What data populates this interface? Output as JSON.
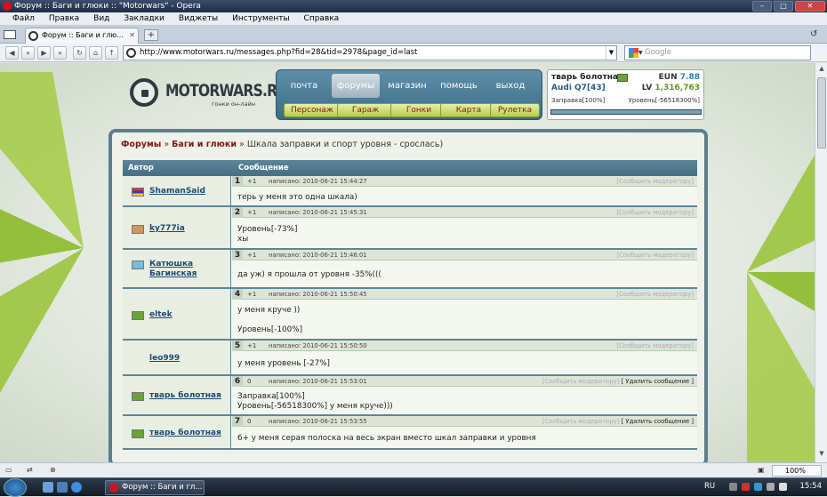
{
  "window": {
    "title": "Форум :: Баги и глюки :: \"Motorwars\" - Opera"
  },
  "menu": [
    "Файл",
    "Правка",
    "Вид",
    "Закладки",
    "Виджеты",
    "Инструменты",
    "Справка"
  ],
  "tab": {
    "label": "Форум :: Баги и глю..."
  },
  "address": {
    "url": "http://www.motorwars.ru/messages.php?fid=28&tid=2978&page_id=last"
  },
  "search": {
    "placeholder": "Google"
  },
  "site": {
    "logo_name": "MOTORWARS.RU",
    "logo_sub": "гонки он-лайн",
    "nav": [
      "почта",
      "форумы",
      "магазин",
      "помощь",
      "выход"
    ],
    "subnav": [
      "Персонаж",
      "Гараж",
      "Гонки",
      "Карта",
      "Рулетка"
    ]
  },
  "user": {
    "name": "тварь болотная",
    "car": "Audi Q7[43]",
    "eun_label": "EUN",
    "eun_value": "7.88",
    "lv_label": "LV",
    "lv_value": "1,316,763",
    "fuel": "Заправка[100%]",
    "level": "Уровень[-56518300%]",
    "fuel_fraction": 1.0
  },
  "forum": {
    "crumb_forums": "Форумы",
    "crumb_sep": "»",
    "crumb_section": "Баги и глюки",
    "crumb_topic": "Шкала заправки и спорт уровня - срослась)",
    "col_author": "Автор",
    "col_message": "Сообщение",
    "report_label": "[Сообщить модератору]",
    "delete_label": "[ Удалить сообщение ]",
    "posts": [
      {
        "num": "1",
        "rating": "+1",
        "date": "написано: 2010-06-21 15:44:27",
        "author": "ShamanSaid",
        "lines": [
          "терь у меня это одна шкала)"
        ],
        "own": false
      },
      {
        "num": "2",
        "rating": "+1",
        "date": "написано: 2010-06-21 15:45:31",
        "author": "ky777ia",
        "lines": [
          "Уровень[-73%]",
          "хы"
        ],
        "own": false
      },
      {
        "num": "3",
        "rating": "+1",
        "date": "написано: 2010-06-21 15:46:01",
        "author": "Катюшка Багинская",
        "lines": [
          "да уж) я прошла от уровня -35%((("
        ],
        "own": false
      },
      {
        "num": "4",
        "rating": "+1",
        "date": "написано: 2010-06-21 15:50:45",
        "author": "eltek",
        "lines": [
          "у меня круче ))",
          "",
          "Уровень[-100%]"
        ],
        "own": false
      },
      {
        "num": "5",
        "rating": "+1",
        "date": "написано: 2010-06-21 15:50:50",
        "author": "leo999",
        "lines": [
          "у меня уровень [-27%]"
        ],
        "own": false
      },
      {
        "num": "6",
        "rating": "0",
        "date": "написано: 2010-06-21 15:53:01",
        "author": "тварь болотная",
        "lines": [
          "Заправка[100%]",
          "Уровень[-56518300%] у меня круче)))"
        ],
        "own": true
      },
      {
        "num": "7",
        "rating": "0",
        "date": "написано: 2010-06-21 15:53:55",
        "author": "тварь болотная",
        "lines": [
          "6+ у меня серая полоска на весь экран вместо шкал заправки и уровня"
        ],
        "own": true
      }
    ]
  },
  "statusbar": {
    "zoom": "100%"
  },
  "taskbar": {
    "task": "Форум :: Баги и гл...",
    "lang": "RU",
    "time": "15:54"
  },
  "colors": {
    "accent": "#5d8597",
    "crumb": "#7b1a12",
    "username": "#1f4a73"
  }
}
